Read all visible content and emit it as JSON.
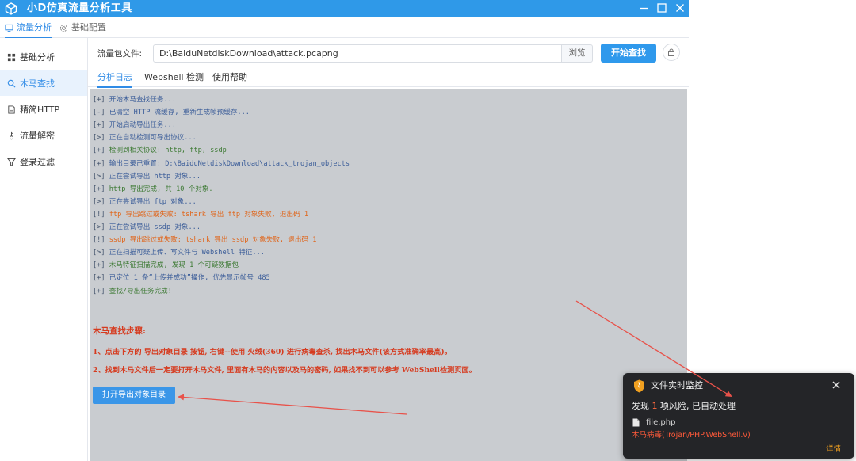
{
  "app": {
    "title": "小D仿真流量分析工具"
  },
  "topnav": {
    "items": [
      {
        "label": "流量分析",
        "icon": "monitor-icon"
      },
      {
        "label": "基础配置",
        "icon": "gear-icon"
      }
    ]
  },
  "sidebar": {
    "items": [
      {
        "label": "基础分析",
        "icon": "grid-icon"
      },
      {
        "label": "木马查找",
        "icon": "search-icon"
      },
      {
        "label": "精简HTTP",
        "icon": "document-icon"
      },
      {
        "label": "流量解密",
        "icon": "key-icon"
      },
      {
        "label": "登录过滤",
        "icon": "filter-icon"
      }
    ]
  },
  "toolbar": {
    "file_label": "流量包文件:",
    "file_path": "D:\\BaiduNetdiskDownload\\attack.pcapng",
    "browse_label": "浏览",
    "start_label": "开始查找"
  },
  "tabs": [
    {
      "label": "分析日志"
    },
    {
      "label": "Webshell 检测"
    },
    {
      "label": "使用帮助"
    }
  ],
  "log": [
    {
      "prefix": "[+]",
      "text": "开始木马查找任务...",
      "color": "#3b5d99"
    },
    {
      "prefix": "[-]",
      "text": "已清空 HTTP 流缓存, 重新生成帧预缓存...",
      "color": "#3b5d99"
    },
    {
      "prefix": "[+]",
      "text": "开始启动导出任务...",
      "color": "#3b5d99"
    },
    {
      "prefix": "[>]",
      "text": "正在自动检测可导出协议...",
      "color": "#3b5d99"
    },
    {
      "prefix": "[+]",
      "text": "检测到相关协议: http, ftp, ssdp",
      "color": "#3d7a34"
    },
    {
      "prefix": "[+]",
      "text": "输出目录已重置: D:\\BaiduNetdiskDownload\\attack_trojan_objects",
      "color": "#3b5d99"
    },
    {
      "prefix": "[>]",
      "text": "正在尝试导出 http 对象...",
      "color": "#3b5d99"
    },
    {
      "prefix": "[+]",
      "text": "http 导出完成, 共 10 个对象.",
      "color": "#3d7a34"
    },
    {
      "prefix": "[>]",
      "text": "正在尝试导出 ftp 对象...",
      "color": "#3b5d99"
    },
    {
      "prefix": "[!]",
      "text": "ftp 导出跳过或失败: tshark 导出 ftp 对象失败, 退出码 1",
      "color": "#e0651a"
    },
    {
      "prefix": "[>]",
      "text": "正在尝试导出 ssdp 对象...",
      "color": "#3b5d99"
    },
    {
      "prefix": "[!]",
      "text": "ssdp 导出跳过或失败: tshark 导出 ssdp 对象失败, 退出码 1",
      "color": "#e0651a"
    },
    {
      "prefix": "[>]",
      "text": "正在扫描可疑上传、写文件与 Webshell 特征...",
      "color": "#3b5d99"
    },
    {
      "prefix": "[+]",
      "text": "木马特征扫描完成, 发现 1 个可疑数据包",
      "color": "#3d7a34"
    },
    {
      "prefix": "[+]",
      "text": "已定位 1 条“上传并成功”操作, 优先显示帧号 485",
      "color": "#3b5d99"
    },
    {
      "prefix": "[+]",
      "text": "查找/导出任务完成!",
      "color": "#3d7a34"
    }
  ],
  "steps": {
    "title": "木马查找步骤:",
    "items": [
      "1、点击下方的 导出对象目录 按钮, 右键--使用 火绒(360) 进行病毒查杀, 找出木马文件(该方式准确率最高)。",
      "2、找到木马文件后一定要打开木马文件, 里面有木马的内容以及马的密码, 如果找不到可以参考 WebShell检测页面。"
    ],
    "export_button": "打开导出对象目录"
  },
  "notification": {
    "title": "文件实时监控",
    "message_prefix": "发现 ",
    "count": "1",
    "message_suffix": " 项风险, 已自动处理",
    "file_name": "file.php",
    "threat": "木马病毒(Trojan/PHP.WebShell.v)",
    "detail_link": "详情"
  },
  "colors": {
    "accent": "#2f99e8",
    "annotation_arrow": "#e8524a",
    "warning": "#e0651a",
    "success": "#3d7a34"
  }
}
